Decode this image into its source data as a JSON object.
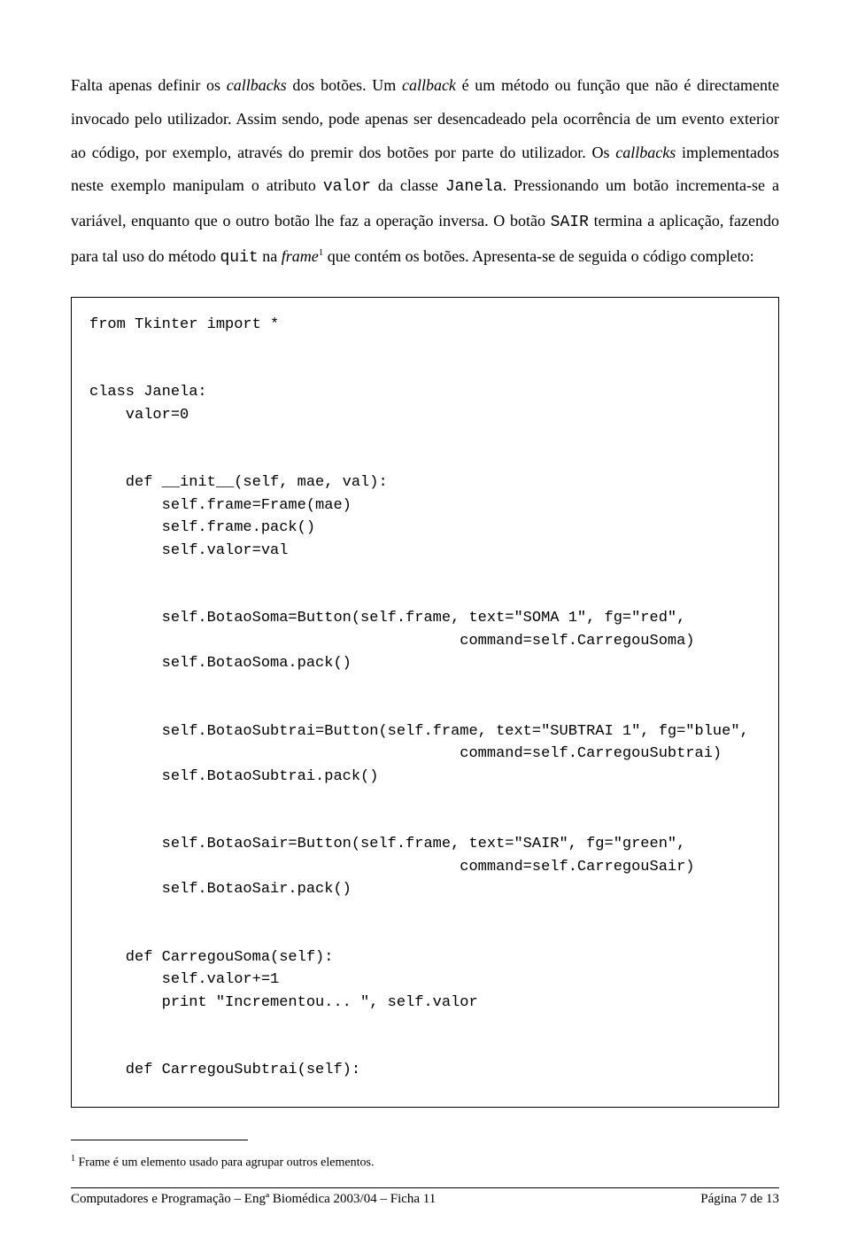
{
  "para": {
    "t1": "Falta apenas definir os ",
    "t2": "callbacks",
    "t3": " dos botões. Um ",
    "t4": "callback",
    "t5": " é um método ou função que não é directamente invocado pelo utilizador. Assim sendo, pode apenas ser desencadeado pela ocorrência de um evento exterior ao código, por exemplo, através do premir dos botões por parte do utilizador. Os ",
    "t6": "callbacks",
    "t7": " implementados neste exemplo manipulam o atributo ",
    "t8": "valor",
    "t9": " da classe ",
    "t10": "Janela",
    "t11": ". Pressionando um botão incrementa-se a variável, enquanto que o outro botão lhe faz a operação inversa. O botão ",
    "t12": "SAIR",
    "t13": " termina a aplicação, fazendo para tal uso do método ",
    "t14": "quit",
    "t15": " na ",
    "t16": "frame",
    "t17": "1",
    "t18": " que contém os botões. Apresenta-se de seguida o código completo:"
  },
  "code": "from Tkinter import *\n\n\nclass Janela:\n    valor=0\n\n\n    def __init__(self, mae, val):\n        self.frame=Frame(mae)\n        self.frame.pack()\n        self.valor=val\n\n\n        self.BotaoSoma=Button(self.frame, text=\"SOMA 1\", fg=\"red\",\n                                         command=self.CarregouSoma)\n        self.BotaoSoma.pack()\n\n\n        self.BotaoSubtrai=Button(self.frame, text=\"SUBTRAI 1\", fg=\"blue\",\n                                         command=self.CarregouSubtrai)\n        self.BotaoSubtrai.pack()\n\n\n        self.BotaoSair=Button(self.frame, text=\"SAIR\", fg=\"green\",\n                                         command=self.CarregouSair)\n        self.BotaoSair.pack()\n\n\n    def CarregouSoma(self):\n        self.valor+=1\n        print \"Incrementou... \", self.valor\n\n\n    def CarregouSubtrai(self):",
  "footnote": {
    "num": "1",
    "text": " Frame é um elemento usado para agrupar outros elementos."
  },
  "footer": {
    "left": "Computadores e Programação – Engª Biomédica 2003/04 – Ficha 11",
    "right": "Página 7 de 13"
  }
}
